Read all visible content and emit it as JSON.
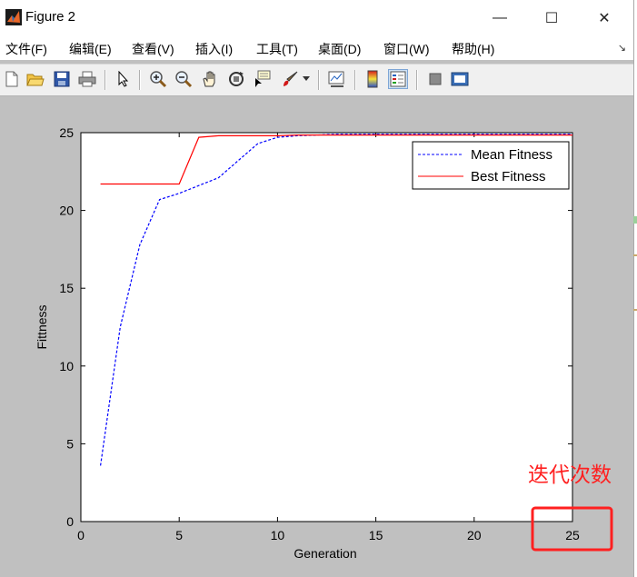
{
  "window": {
    "title": "Figure 2",
    "minimize_glyph": "—",
    "maximize_glyph": "☐",
    "close_glyph": "✕"
  },
  "menu": {
    "items": [
      "文件(F)",
      "编辑(E)",
      "查看(V)",
      "插入(I)",
      "工具(T)",
      "桌面(D)",
      "窗口(W)",
      "帮助(H)"
    ],
    "overflow_glyph": "↘"
  },
  "toolbar": {
    "icons": [
      "new-figure-icon",
      "open-file-icon",
      "save-icon",
      "print-icon",
      "pointer-icon",
      "zoom-in-icon",
      "zoom-out-icon",
      "pan-hand-icon",
      "rotate-3d-icon",
      "data-cursor-icon",
      "brush-icon",
      "link-plot-icon",
      "colorbar-icon",
      "legend-icon",
      "hide-plot-tools-icon",
      "show-plot-tools-icon"
    ]
  },
  "annotation": {
    "text": "迭代次数",
    "color": "#ff2020"
  },
  "chart_data": {
    "type": "line",
    "xlabel": "Generation",
    "ylabel": "Fittness",
    "xlim": [
      0,
      25
    ],
    "ylim": [
      0,
      25
    ],
    "xticks": [
      0,
      5,
      10,
      15,
      20,
      25
    ],
    "yticks": [
      0,
      5,
      10,
      15,
      20,
      25
    ],
    "grid": false,
    "legend_position": "top-right",
    "series": [
      {
        "name": "Mean Fitness",
        "color": "#0000ff",
        "style": "dashed",
        "x": [
          1,
          2,
          3,
          4,
          5,
          6,
          7,
          8,
          9,
          10,
          11,
          12,
          13,
          14,
          15,
          16,
          17,
          18,
          19,
          20,
          21,
          22,
          23,
          24,
          25
        ],
        "y": [
          3.6,
          12.5,
          17.8,
          20.7,
          21.1,
          21.6,
          22.1,
          23.2,
          24.3,
          24.7,
          24.8,
          24.85,
          24.9,
          24.9,
          24.9,
          24.9,
          24.9,
          24.9,
          24.9,
          24.9,
          24.9,
          24.9,
          24.9,
          24.9,
          24.9
        ]
      },
      {
        "name": "Best Fitness",
        "color": "#ff0000",
        "style": "solid",
        "x": [
          1,
          2,
          3,
          4,
          5,
          6,
          7,
          8,
          9,
          10,
          11,
          12,
          13,
          14,
          15,
          16,
          17,
          18,
          19,
          20,
          21,
          22,
          23,
          24,
          25
        ],
        "y": [
          21.7,
          21.7,
          21.7,
          21.7,
          21.7,
          24.7,
          24.8,
          24.8,
          24.8,
          24.8,
          24.85,
          24.85,
          24.85,
          24.85,
          24.85,
          24.85,
          24.85,
          24.85,
          24.85,
          24.85,
          24.85,
          24.85,
          24.85,
          24.85,
          24.85
        ]
      }
    ]
  }
}
